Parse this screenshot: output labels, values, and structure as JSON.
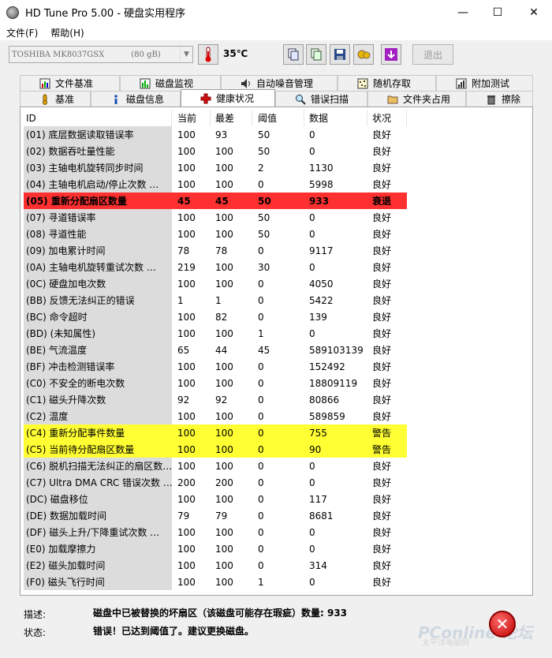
{
  "window": {
    "title": "HD Tune Pro 5.00 - 硬盘实用程序",
    "min": "—",
    "max": "☐",
    "close": "✕"
  },
  "menu": [
    "文件(F)",
    "帮助(H)"
  ],
  "toolbar": {
    "drive_name": "TOSHIBA MK8037GSX",
    "drive_size": "(80 gB)",
    "temperature": "35℃",
    "exit_label": "退出"
  },
  "tabs_row1": [
    {
      "label": "文件基准",
      "icon": "file-benchmark-icon"
    },
    {
      "label": "磁盘监视",
      "icon": "disk-monitor-icon"
    },
    {
      "label": "自动噪音管理",
      "icon": "speaker-icon"
    },
    {
      "label": "随机存取",
      "icon": "random-access-icon"
    },
    {
      "label": "附加测试",
      "icon": "extra-tests-icon"
    }
  ],
  "tabs_row2": [
    {
      "label": "基准",
      "icon": "benchmark-icon"
    },
    {
      "label": "磁盘信息",
      "icon": "info-icon"
    },
    {
      "label": "健康状况",
      "icon": "health-cross-icon"
    },
    {
      "label": "错误扫描",
      "icon": "magnifier-icon"
    },
    {
      "label": "文件夹占用",
      "icon": "folder-icon"
    },
    {
      "label": "擦除",
      "icon": "trash-icon"
    }
  ],
  "table": {
    "headers": [
      "ID",
      "当前",
      "最差",
      "阈值",
      "数据",
      "状况"
    ],
    "rows": [
      {
        "id": "(01) 底层数据读取错误率",
        "cur": "100",
        "worst": "93",
        "thr": "50",
        "data": "0",
        "status": "良好"
      },
      {
        "id": "(02) 数据吞吐量性能",
        "cur": "100",
        "worst": "100",
        "thr": "50",
        "data": "0",
        "status": "良好"
      },
      {
        "id": "(03) 主轴电机旋转同步时间",
        "cur": "100",
        "worst": "100",
        "thr": "2",
        "data": "1130",
        "status": "良好"
      },
      {
        "id": "(04) 主轴电机启动/停止次数  …",
        "cur": "100",
        "worst": "100",
        "thr": "0",
        "data": "5998",
        "status": "良好"
      },
      {
        "id": "(05) 重新分配扇区数量",
        "cur": "45",
        "worst": "45",
        "thr": "50",
        "data": "933",
        "status": "衰退",
        "level": "crit"
      },
      {
        "id": "(07) 寻道错误率",
        "cur": "100",
        "worst": "100",
        "thr": "50",
        "data": "0",
        "status": "良好"
      },
      {
        "id": "(08) 寻道性能",
        "cur": "100",
        "worst": "100",
        "thr": "50",
        "data": "0",
        "status": "良好"
      },
      {
        "id": "(09) 加电累计时间",
        "cur": "78",
        "worst": "78",
        "thr": "0",
        "data": "9117",
        "status": "良好"
      },
      {
        "id": "(0A) 主轴电机旋转重试次数  …",
        "cur": "219",
        "worst": "100",
        "thr": "30",
        "data": "0",
        "status": "良好"
      },
      {
        "id": "(0C) 硬盘加电次数",
        "cur": "100",
        "worst": "100",
        "thr": "0",
        "data": "4050",
        "status": "良好"
      },
      {
        "id": "(BB) 反馈无法纠正的错误",
        "cur": "1",
        "worst": "1",
        "thr": "0",
        "data": "5422",
        "status": "良好"
      },
      {
        "id": "(BC) 命令超时",
        "cur": "100",
        "worst": "82",
        "thr": "0",
        "data": "139",
        "status": "良好"
      },
      {
        "id": "(BD) (未知属性)",
        "cur": "100",
        "worst": "100",
        "thr": "1",
        "data": "0",
        "status": "良好"
      },
      {
        "id": "(BE) 气流温度",
        "cur": "65",
        "worst": "44",
        "thr": "45",
        "data": "589103139",
        "status": "良好"
      },
      {
        "id": "(BF) 冲击检测错误率",
        "cur": "100",
        "worst": "100",
        "thr": "0",
        "data": "152492",
        "status": "良好"
      },
      {
        "id": "(C0) 不安全的断电次数",
        "cur": "100",
        "worst": "100",
        "thr": "0",
        "data": "18809119",
        "status": "良好"
      },
      {
        "id": "(C1) 磁头升降次数",
        "cur": "92",
        "worst": "92",
        "thr": "0",
        "data": "80866",
        "status": "良好"
      },
      {
        "id": "(C2) 温度",
        "cur": "100",
        "worst": "100",
        "thr": "0",
        "data": "589859",
        "status": "良好"
      },
      {
        "id": "(C4) 重新分配事件数量",
        "cur": "100",
        "worst": "100",
        "thr": "0",
        "data": "755",
        "status": "警告",
        "level": "warn"
      },
      {
        "id": "(C5) 当前待分配扇区数量",
        "cur": "100",
        "worst": "100",
        "thr": "0",
        "data": "90",
        "status": "警告",
        "level": "warn"
      },
      {
        "id": "(C6) 脱机扫描无法纠正的扇区数…",
        "cur": "100",
        "worst": "100",
        "thr": "0",
        "data": "0",
        "status": "良好"
      },
      {
        "id": "(C7) Ultra DMA CRC 错误次数  …",
        "cur": "200",
        "worst": "200",
        "thr": "0",
        "data": "0",
        "status": "良好"
      },
      {
        "id": "(DC) 磁盘移位",
        "cur": "100",
        "worst": "100",
        "thr": "0",
        "data": "117",
        "status": "良好"
      },
      {
        "id": "(DE) 数据加载时间",
        "cur": "79",
        "worst": "79",
        "thr": "0",
        "data": "8681",
        "status": "良好"
      },
      {
        "id": "(DF) 磁头上升/下降重试次数  …",
        "cur": "100",
        "worst": "100",
        "thr": "0",
        "data": "0",
        "status": "良好"
      },
      {
        "id": "(E0) 加载摩擦力",
        "cur": "100",
        "worst": "100",
        "thr": "0",
        "data": "0",
        "status": "良好"
      },
      {
        "id": "(E2) 磁头加载时间",
        "cur": "100",
        "worst": "100",
        "thr": "0",
        "data": "314",
        "status": "良好"
      },
      {
        "id": "(F0) 磁头飞行时间",
        "cur": "100",
        "worst": "100",
        "thr": "1",
        "data": "0",
        "status": "良好"
      }
    ]
  },
  "footer": {
    "desc_label": "描述:",
    "desc_text": "磁盘中已被替换的坏扇区（该磁盘可能存在瑕疵）数量: 933",
    "status_label": "状态:",
    "status_text": "错误！已达到阈值了。建议更换磁盘。",
    "error_icon_glyph": "✕",
    "watermark": "PConline 论坛",
    "watermark_sub": "太平洋电脑网"
  },
  "colors": {
    "critical": "#ff3030",
    "warning": "#ffff33",
    "id_column": "#dcdcdc"
  }
}
